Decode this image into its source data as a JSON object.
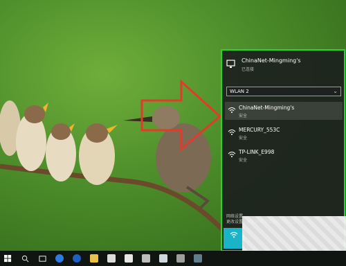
{
  "network_flyout": {
    "connected": {
      "ssid": "ChinaNet-Mingming's",
      "status": "已连接"
    },
    "adapter": {
      "value": "WLAN 2"
    },
    "networks": [
      {
        "ssid": "ChinaNet-Mingming's",
        "status": "安全"
      },
      {
        "ssid": "MERCURY_553C",
        "status": "安全"
      },
      {
        "ssid": "TP-LINK_E998",
        "status": "安全"
      }
    ],
    "footer_text_line1": "网络设置",
    "footer_text_line2": "更改设置，例如将某连接设置为按流量计费。"
  },
  "colors": {
    "highlight_border": "#27d62b",
    "arrow": "#e23b2a",
    "wifi_tile": "#1ab3c8",
    "taskbar": "#101512"
  },
  "taskbar": {
    "icons": [
      "windows-start-icon",
      "search-icon",
      "task-view-icon",
      "edge-icon",
      "ie-icon",
      "file-explorer-icon",
      "store-icon",
      "mail-icon",
      "calculator-icon",
      "app-icon",
      "app-icon-2",
      "app-icon-3"
    ]
  }
}
